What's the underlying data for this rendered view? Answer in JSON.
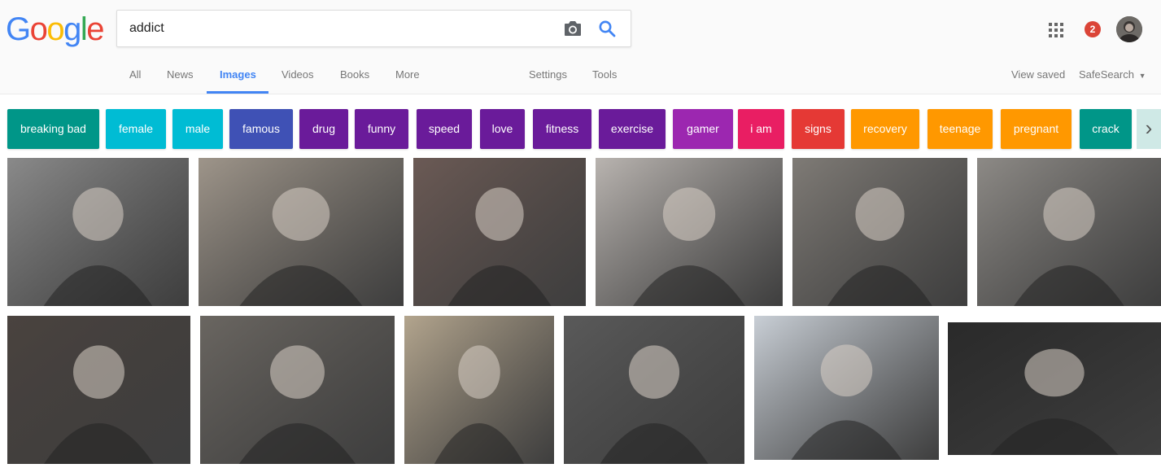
{
  "logo": {
    "letters": [
      "G",
      "o",
      "o",
      "g",
      "l",
      "e"
    ],
    "colors": [
      "#4285f4",
      "#ea4335",
      "#fbbc05",
      "#4285f4",
      "#34a853",
      "#ea4335"
    ]
  },
  "search": {
    "query": "addict",
    "camera_icon": "camera-icon",
    "search_icon": "search-icon"
  },
  "account": {
    "apps_icon": "apps-grid-icon",
    "notification_count": "2",
    "avatar_icon": "avatar"
  },
  "nav": {
    "tabs": [
      "All",
      "News",
      "Images",
      "Videos",
      "Books",
      "More"
    ],
    "active_tab": "Images",
    "settings": "Settings",
    "tools": "Tools",
    "view_saved": "View saved",
    "safesearch": "SafeSearch"
  },
  "chips": [
    {
      "label": "breaking bad",
      "color": "#009688"
    },
    {
      "label": "female",
      "color": "#00bcd4"
    },
    {
      "label": "male",
      "color": "#00bcd4"
    },
    {
      "label": "famous",
      "color": "#3f51b5"
    },
    {
      "label": "drug",
      "color": "#6a1b9a"
    },
    {
      "label": "funny",
      "color": "#6a1b9a"
    },
    {
      "label": "speed",
      "color": "#6a1b9a"
    },
    {
      "label": "love",
      "color": "#6a1b9a"
    },
    {
      "label": "fitness",
      "color": "#6a1b9a"
    },
    {
      "label": "exercise",
      "color": "#6a1b9a"
    },
    {
      "label": "gamer",
      "color": "#9c27b0"
    },
    {
      "label": "i am",
      "color": "#e91e63"
    },
    {
      "label": "signs",
      "color": "#e53935"
    },
    {
      "label": "recovery",
      "color": "#ff9800"
    },
    {
      "label": "teenage",
      "color": "#ff9800"
    },
    {
      "label": "pregnant",
      "color": "#ff9800"
    },
    {
      "label": "crack",
      "color": "#009688"
    }
  ],
  "chip_next_icon": "chevron-right-icon",
  "results": [
    {
      "tone": "#8a8a8a"
    },
    {
      "tone": "#9e958a"
    },
    {
      "tone": "#6b5a55"
    },
    {
      "tone": "#b9b4b0"
    },
    {
      "tone": "#7f7b76"
    },
    {
      "tone": "#8d8a86"
    },
    {
      "tone": "#4a433f"
    },
    {
      "tone": "#6a6661"
    },
    {
      "tone": "#b3a58e"
    },
    {
      "tone": "#5a5a5a"
    },
    {
      "tone": "#c9cfd6"
    },
    {
      "tone": "#2a2a2a"
    }
  ]
}
